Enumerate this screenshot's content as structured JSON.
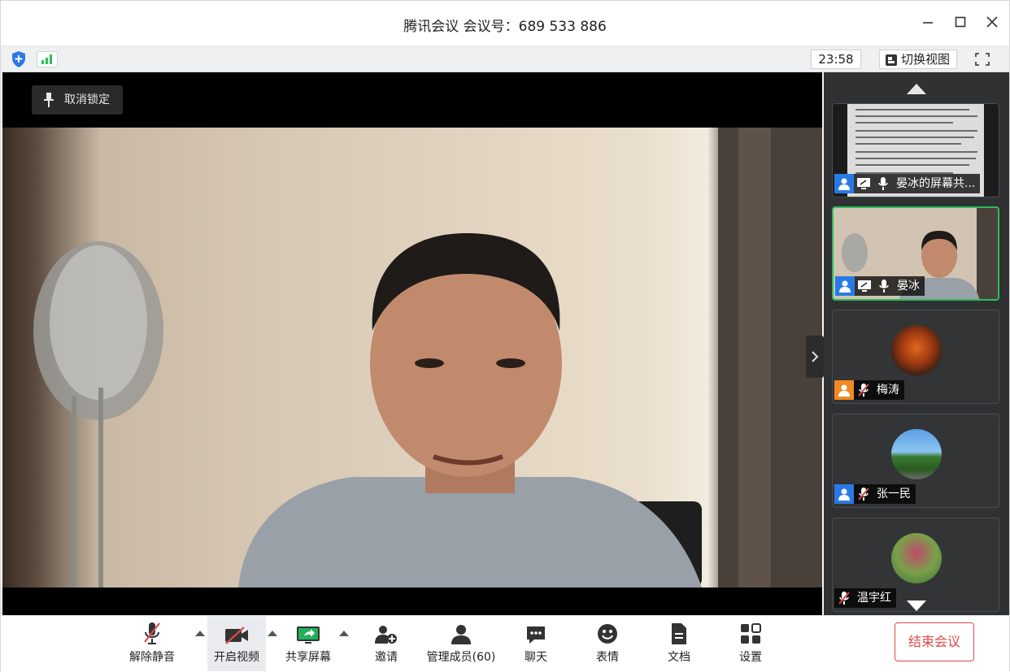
{
  "window": {
    "title": "腾讯会议 会议号：689 533 886",
    "controls": [
      "minimize",
      "maximize",
      "close"
    ]
  },
  "status": {
    "time": "23:58",
    "switch_view_label": "切换视图",
    "icons": [
      "shield-icon",
      "signal-icon",
      "fullscreen-icon"
    ]
  },
  "stage": {
    "pin_label": "取消锁定"
  },
  "participants": [
    {
      "name": "晏冰的屏幕共...",
      "type": "screen-share",
      "avatar_color": "#2b79e6"
    },
    {
      "name": "晏冰",
      "type": "video",
      "active": true,
      "avatar_color": "#2b79e6"
    },
    {
      "name": "梅涛",
      "type": "avatar",
      "muted": true,
      "avatar_color": "#f08a24"
    },
    {
      "name": "张一民",
      "type": "avatar",
      "muted": true,
      "avatar_color": "#2b79e6"
    },
    {
      "name": "温宇红",
      "type": "avatar",
      "muted": true
    }
  ],
  "toolbar": {
    "unmute": "解除静音",
    "video": "开启视频",
    "share": "共享屏幕",
    "invite": "邀请",
    "members": "管理成员(60)",
    "chat": "聊天",
    "emoji": "表情",
    "docs": "文档",
    "settings": "设置",
    "end": "结束会议"
  },
  "colors": {
    "accent": "#2b79e6",
    "danger": "#e04848",
    "active_border": "#2bbd5a"
  }
}
